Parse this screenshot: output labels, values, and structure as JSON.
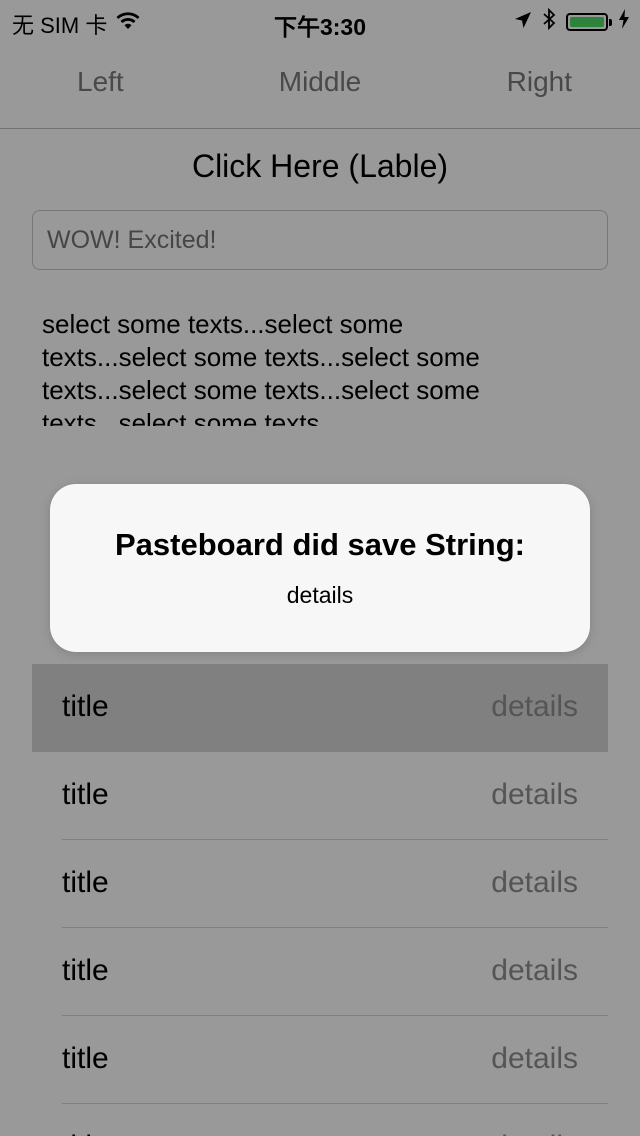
{
  "status_bar": {
    "carrier": "无 SIM 卡",
    "time": "下午3:30",
    "battery_level": 1.0
  },
  "nav": {
    "left": "Left",
    "middle": "Middle",
    "right": "Right"
  },
  "main": {
    "click_label": "Click Here (Lable)",
    "text_field_placeholder": "WOW! Excited!",
    "text_view_lines": [
      "select some texts...select some",
      "texts...select some texts...select some",
      "texts...select some texts...select some",
      "texts...select some texts"
    ]
  },
  "table": {
    "rows": [
      {
        "title": "title",
        "detail": "details"
      },
      {
        "title": "title",
        "detail": "details"
      },
      {
        "title": "title",
        "detail": "details"
      },
      {
        "title": "title",
        "detail": "details"
      },
      {
        "title": "title",
        "detail": "details"
      },
      {
        "title": "title",
        "detail": "details"
      }
    ]
  },
  "alert": {
    "title": "Pasteboard did save String:",
    "message": "details"
  },
  "colors": {
    "battery": "#4cd964",
    "overlay": "rgba(0,0,0,0.40)"
  }
}
